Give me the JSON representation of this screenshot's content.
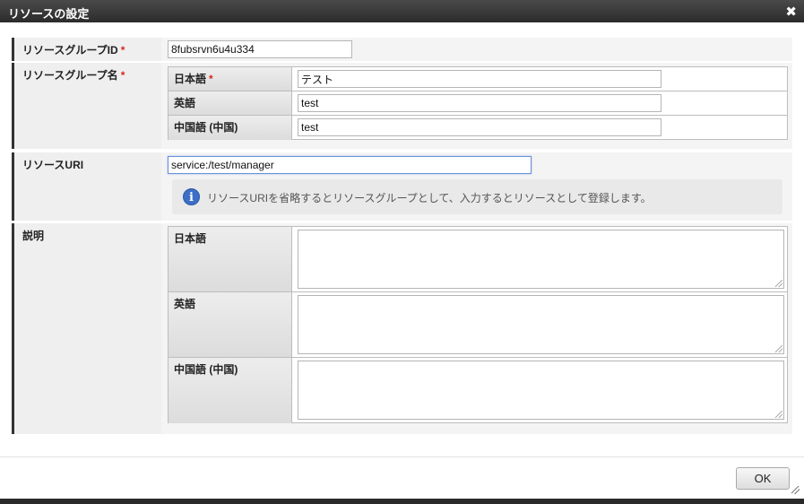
{
  "dialog": {
    "title": "リソースの設定",
    "close_glyph": "✖",
    "close_icon": "close-icon"
  },
  "group_id": {
    "label": "リソースグループID",
    "required_mark": "*",
    "value": "8fubsrvn6u4u334"
  },
  "group_name": {
    "label": "リソースグループ名",
    "required_mark": "*",
    "rows": [
      {
        "lang": "日本語",
        "required_mark": "*",
        "value": "テスト"
      },
      {
        "lang": "英語",
        "required_mark": "",
        "value": "test"
      },
      {
        "lang": "中国語 (中国)",
        "required_mark": "",
        "value": "test"
      }
    ]
  },
  "uri": {
    "label": "リソースURI",
    "value": "service:/test/manager",
    "info_icon": "info-icon",
    "info_glyph": "i",
    "info_message": "リソースURIを省略するとリソースグループとして、入力するとリソースとして登録します。"
  },
  "description": {
    "label": "説明",
    "rows": [
      {
        "lang": "日本語",
        "value": ""
      },
      {
        "lang": "英語",
        "value": ""
      },
      {
        "lang": "中国語 (中国)",
        "value": ""
      }
    ]
  },
  "footer": {
    "ok_label": "OK"
  },
  "colors": {
    "titlebar": "#2b2b2b",
    "required": "#d9261c",
    "info_icon": "#3e6fc7"
  }
}
